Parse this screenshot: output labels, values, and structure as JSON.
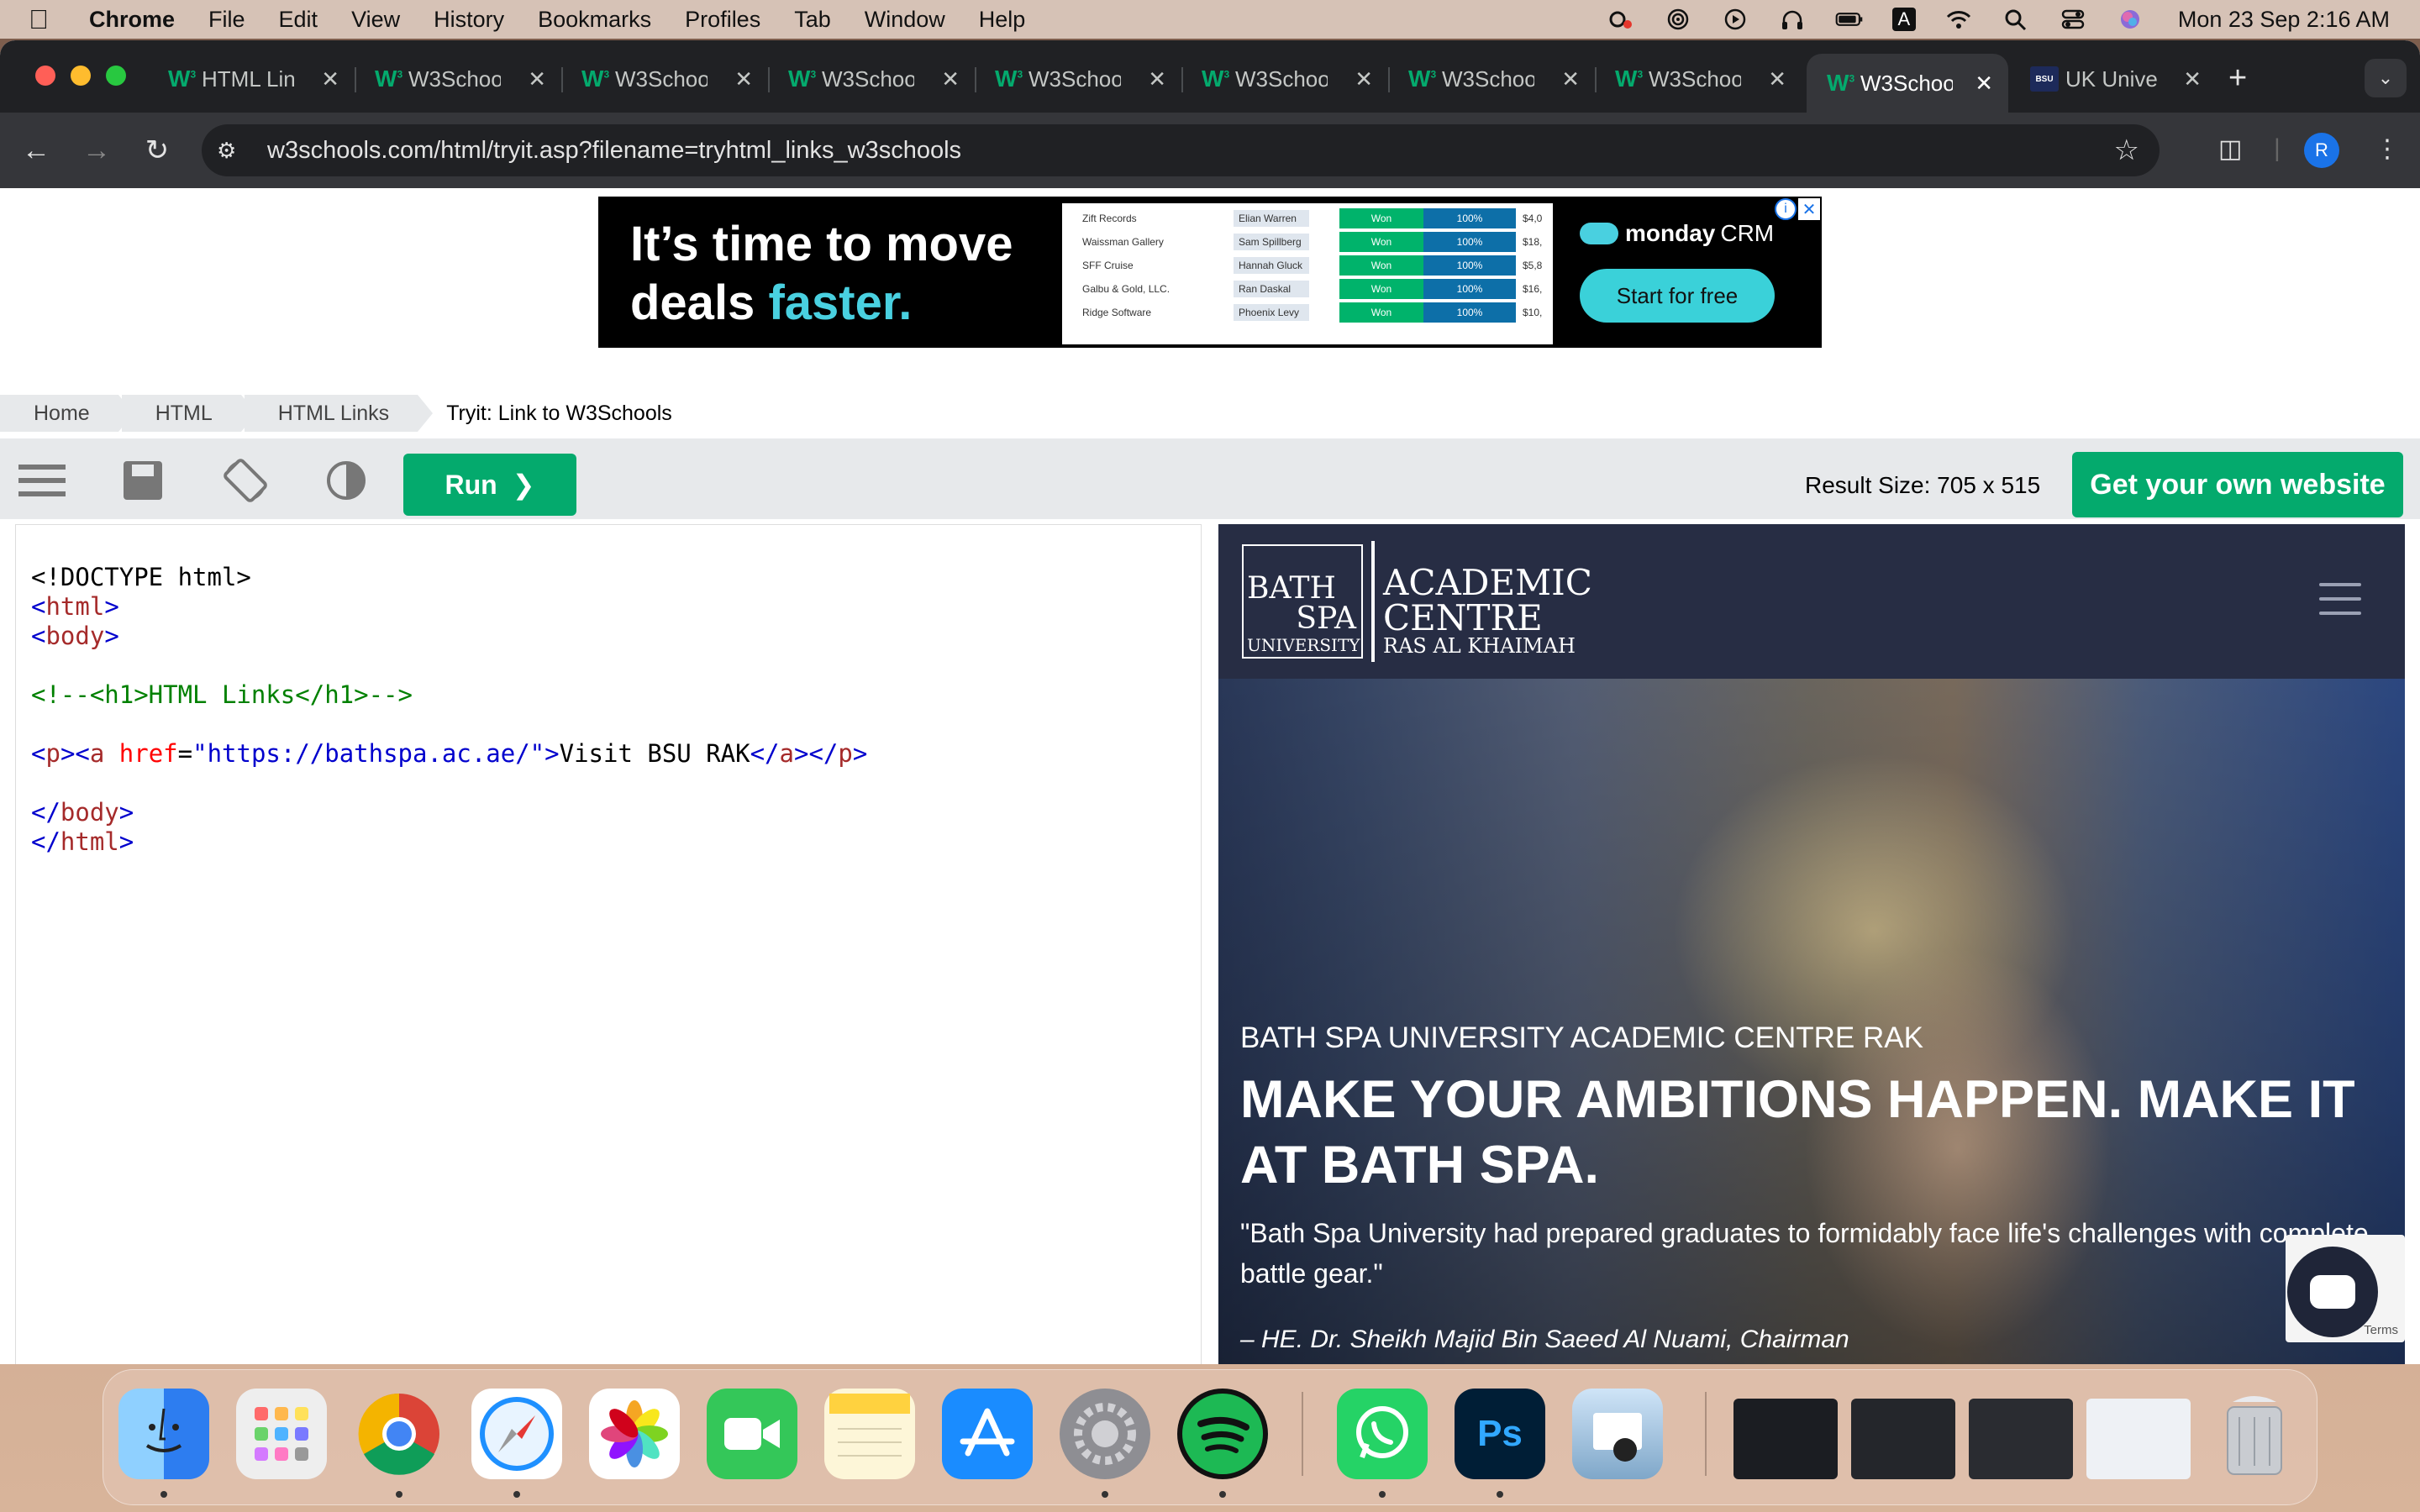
{
  "menubar": {
    "app_name": "Chrome",
    "items": [
      "File",
      "Edit",
      "View",
      "History",
      "Bookmarks",
      "Profiles",
      "Tab",
      "Window",
      "Help"
    ],
    "clock": "Mon 23 Sep  2:16 AM",
    "input_source": "A",
    "status_icons": [
      "creative-cloud-icon",
      "airdrop-icon",
      "play-icon",
      "headphones-icon",
      "battery-icon",
      "input-source-icon",
      "wifi-icon",
      "spotlight-icon",
      "control-center-icon",
      "siri-icon"
    ]
  },
  "browser": {
    "tabs": [
      {
        "title": "HTML Lin",
        "favicon": "w3schools-icon",
        "active": false
      },
      {
        "title": "W3Schoo",
        "favicon": "w3schools-icon",
        "active": false
      },
      {
        "title": "W3Schoo",
        "favicon": "w3schools-icon",
        "active": false
      },
      {
        "title": "W3Schoo",
        "favicon": "w3schools-icon",
        "active": false
      },
      {
        "title": "W3Schoo",
        "favicon": "w3schools-icon",
        "active": false
      },
      {
        "title": "W3Schoo",
        "favicon": "w3schools-icon",
        "active": false
      },
      {
        "title": "W3Schoo",
        "favicon": "w3schools-icon",
        "active": false
      },
      {
        "title": "W3Schoo",
        "favicon": "w3schools-icon",
        "active": false
      },
      {
        "title": "W3Schoo",
        "favicon": "w3schools-icon",
        "active": true
      },
      {
        "title": "UK Unive",
        "favicon": "bath-spa-icon",
        "active": false
      }
    ],
    "url": "w3schools.com/html/tryit.asp?filename=tryhtml_links_w3schools",
    "profile_initial": "R"
  },
  "ad": {
    "headline_1": "It’s time to move",
    "headline_2a": "deals ",
    "headline_2b": "faster.",
    "brand": "monday",
    "brand_suffix": "CRM",
    "cta": "Start for free",
    "table_rows": [
      {
        "company": "Zift Records",
        "owner": "Elian Warren",
        "status": "Won",
        "pct": "100%",
        "amount": "$4,0"
      },
      {
        "company": "Waissman Gallery",
        "owner": "Sam Spillberg",
        "status": "Won",
        "pct": "100%",
        "amount": "$18,"
      },
      {
        "company": "SFF Cruise",
        "owner": "Hannah Gluck",
        "status": "Won",
        "pct": "100%",
        "amount": "$5,8"
      },
      {
        "company": "Galbu & Gold, LLC.",
        "owner": "Ran Daskal",
        "status": "Won",
        "pct": "100%",
        "amount": "$16,"
      },
      {
        "company": "Ridge Software",
        "owner": "Phoenix Levy",
        "status": "Won",
        "pct": "100%",
        "amount": "$10,"
      }
    ],
    "colors": {
      "accent": "#49d0e0",
      "won": "#00b36b",
      "pct": "#0d6fa8"
    }
  },
  "breadcrumb": {
    "items": [
      "Home",
      "HTML",
      "HTML Links"
    ],
    "current": "Tryit: Link to W3Schools"
  },
  "editor": {
    "run_label": "Run",
    "result_size": "Result Size: 705 x 515",
    "own_site_label": "Get your own website",
    "code": {
      "l1": "<!DOCTYPE html>",
      "l2_tag": "html",
      "l3_tag": "body",
      "l5_comment": "<!--<h1>HTML Links</h1>-->",
      "l7_p": "p",
      "l7_a": "a",
      "l7_attr": "href",
      "l7_val": "\"https://bathspa.ac.ae/\"",
      "l7_text": "Visit BSU RAK",
      "l9_tag": "body",
      "l10_tag": "html"
    },
    "colors": {
      "primary": "#04aa6d",
      "toolbar": "#e7e9eb"
    }
  },
  "result_site": {
    "logo_bath": "BATH",
    "logo_spa": "SPA",
    "logo_university": "UNIVERSITY",
    "logo_academic": "ACADEMIC",
    "logo_centre": "CENTRE",
    "logo_location": "RAS AL KHAIMAH",
    "kicker": "BATH SPA UNIVERSITY ACADEMIC CENTRE RAK",
    "title": "MAKE YOUR AMBITIONS HAPPEN. MAKE IT AT BATH SPA.",
    "quote": "\"Bath Spa University had prepared graduates to formidably face life's challenges with complete battle gear.\"",
    "attribution": "– HE. Dr. Sheikh Majid Bin Saeed Al Nuami, Chairman",
    "terms": "Terms",
    "header_color": "#272d44"
  },
  "dock": {
    "apps": [
      {
        "name": "Finder",
        "icon": "finder-icon"
      },
      {
        "name": "Launchpad",
        "icon": "launchpad-icon"
      },
      {
        "name": "Chrome",
        "icon": "chrome-icon"
      },
      {
        "name": "Safari",
        "icon": "safari-icon"
      },
      {
        "name": "Photos",
        "icon": "photos-icon"
      },
      {
        "name": "FaceTime",
        "icon": "facetime-icon"
      },
      {
        "name": "Notes",
        "icon": "notes-icon"
      },
      {
        "name": "App Store",
        "icon": "app-store-icon"
      },
      {
        "name": "System Settings",
        "icon": "settings-icon"
      },
      {
        "name": "Spotify",
        "icon": "spotify-icon"
      },
      {
        "name": "WhatsApp",
        "icon": "whatsapp-icon"
      },
      {
        "name": "Photoshop",
        "icon": "photoshop-icon",
        "label": "Ps"
      },
      {
        "name": "Preview",
        "icon": "preview-icon"
      }
    ]
  }
}
